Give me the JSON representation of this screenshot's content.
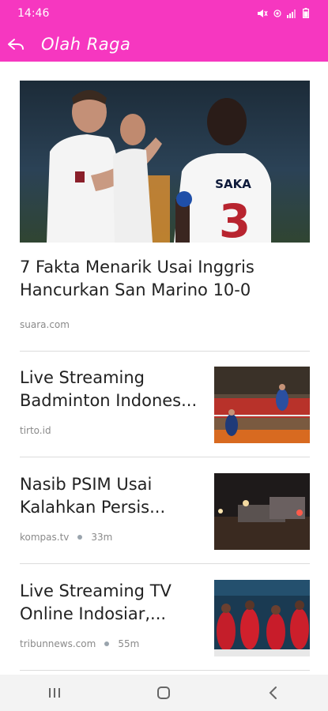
{
  "status_bar": {
    "time": "14:46"
  },
  "app_bar": {
    "title": "Olah Raga"
  },
  "hero": {
    "title": "7 Fakta Menarik Usai Inggris Hancurkan San Marino 10-0",
    "source": "suara.com",
    "jersey_name": "SAKA",
    "jersey_number": "3"
  },
  "articles": [
    {
      "title": "Live Streaming Badminton Indones...",
      "source": "tirto.id",
      "time": ""
    },
    {
      "title": "Nasib PSIM Usai Kalahkan Persis...",
      "source": "kompas.tv",
      "time": "33m"
    },
    {
      "title": "Live Streaming TV Online Indosiar,...",
      "source": "tribunnews.com",
      "time": "55m"
    }
  ]
}
